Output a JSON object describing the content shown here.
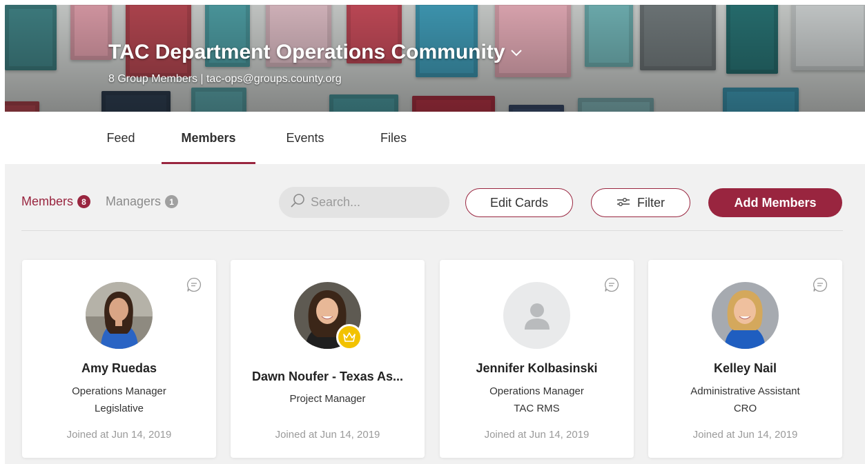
{
  "group": {
    "title": "TAC Department Operations Community",
    "subtitle": "8 Group Members | tac-ops@groups.county.org"
  },
  "tabs": [
    {
      "label": "Feed",
      "active": false
    },
    {
      "label": "Members",
      "active": true
    },
    {
      "label": "Events",
      "active": false
    },
    {
      "label": "Files",
      "active": false
    }
  ],
  "toolbar": {
    "members_label": "Members",
    "members_count": "8",
    "managers_label": "Managers",
    "managers_count": "1",
    "search_placeholder": "Search...",
    "edit_cards_label": "Edit Cards",
    "filter_label": "Filter",
    "add_members_label": "Add Members"
  },
  "colors": {
    "accent": "#99253f",
    "manager_badge": "#f2c200"
  },
  "members": [
    {
      "name": "Amy Ruedas",
      "role": "Operations Manager",
      "dept": "Legislative",
      "joined": "Joined at Jun 14, 2019",
      "avatar": "photo-woman-dark-hair-blue-top",
      "is_manager": false
    },
    {
      "name": "Dawn Noufer - Texas As...",
      "role": "Project Manager",
      "dept": "",
      "joined": "Joined at Jun 14, 2019",
      "avatar": "photo-woman-dark-hair-smiling",
      "is_manager": true
    },
    {
      "name": "Jennifer Kolbasinski",
      "role": "Operations Manager",
      "dept": "TAC RMS",
      "joined": "Joined at Jun 14, 2019",
      "avatar": "placeholder-user-icon",
      "is_manager": false
    },
    {
      "name": "Kelley Nail",
      "role": "Administrative Assistant",
      "dept": "CRO",
      "joined": "Joined at Jun 14, 2019",
      "avatar": "photo-woman-blonde-blue-top",
      "is_manager": false
    }
  ]
}
